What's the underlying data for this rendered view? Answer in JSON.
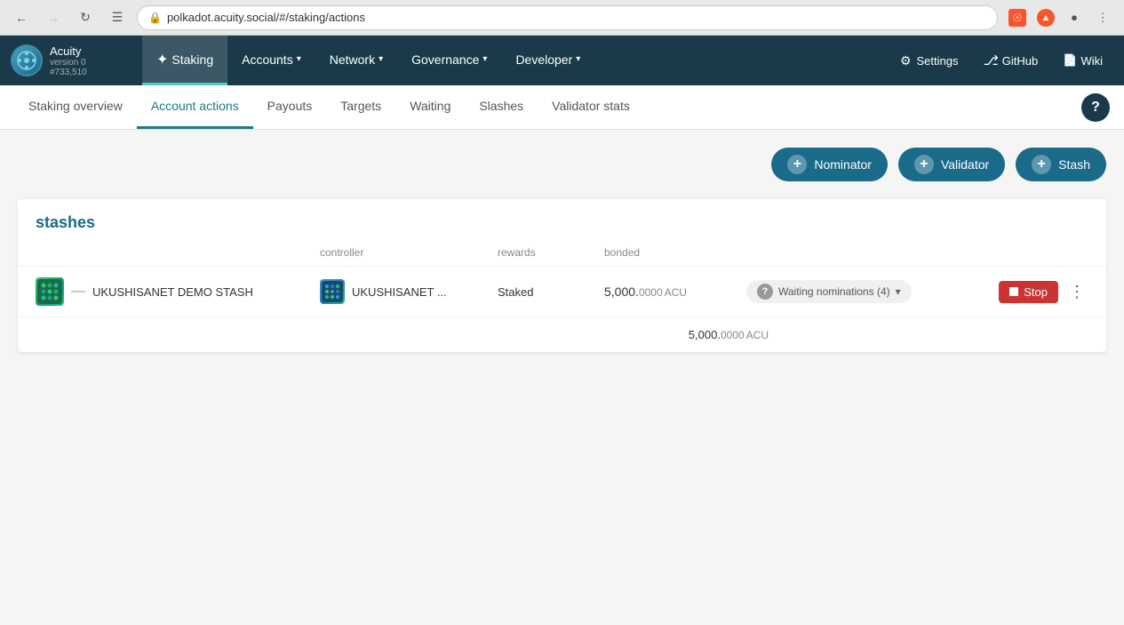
{
  "browser": {
    "url": "polkadot.acuity.social/#/staking/actions",
    "back_disabled": false,
    "forward_disabled": false
  },
  "topnav": {
    "logo": {
      "name": "Acuity",
      "version": "version 0",
      "block": "#733,510"
    },
    "items": [
      {
        "id": "staking",
        "label": "Staking",
        "active": true,
        "has_dropdown": false
      },
      {
        "id": "accounts",
        "label": "Accounts",
        "active": false,
        "has_dropdown": true
      },
      {
        "id": "network",
        "label": "Network",
        "active": false,
        "has_dropdown": true
      },
      {
        "id": "governance",
        "label": "Governance",
        "active": false,
        "has_dropdown": true
      },
      {
        "id": "developer",
        "label": "Developer",
        "active": false,
        "has_dropdown": true
      }
    ],
    "settings_label": "Settings",
    "github_label": "GitHub",
    "wiki_label": "Wiki"
  },
  "subtabs": [
    {
      "id": "staking-overview",
      "label": "Staking overview",
      "active": false
    },
    {
      "id": "account-actions",
      "label": "Account actions",
      "active": true
    },
    {
      "id": "payouts",
      "label": "Payouts",
      "active": false
    },
    {
      "id": "targets",
      "label": "Targets",
      "active": false
    },
    {
      "id": "waiting",
      "label": "Waiting",
      "active": false
    },
    {
      "id": "slashes",
      "label": "Slashes",
      "active": false
    },
    {
      "id": "validator-stats",
      "label": "Validator stats",
      "active": false
    }
  ],
  "action_buttons": [
    {
      "id": "nominator",
      "label": "Nominator"
    },
    {
      "id": "validator",
      "label": "Validator"
    },
    {
      "id": "stash",
      "label": "Stash"
    }
  ],
  "stashes": {
    "title": "stashes",
    "columns": {
      "controller": "controller",
      "rewards": "rewards",
      "bonded": "bonded"
    },
    "rows": [
      {
        "stash_name": "UKUSHISANET DEMO STASH",
        "controller_name": "UKUSHISANET ...",
        "rewards": "Staked",
        "bonded_integer": "5,000.",
        "bonded_decimal": "0000",
        "bonded_unit": "ACU",
        "status_label": "Waiting nominations (4)"
      }
    ],
    "total_integer": "5,000.",
    "total_decimal": "0000",
    "total_unit": "ACU"
  }
}
